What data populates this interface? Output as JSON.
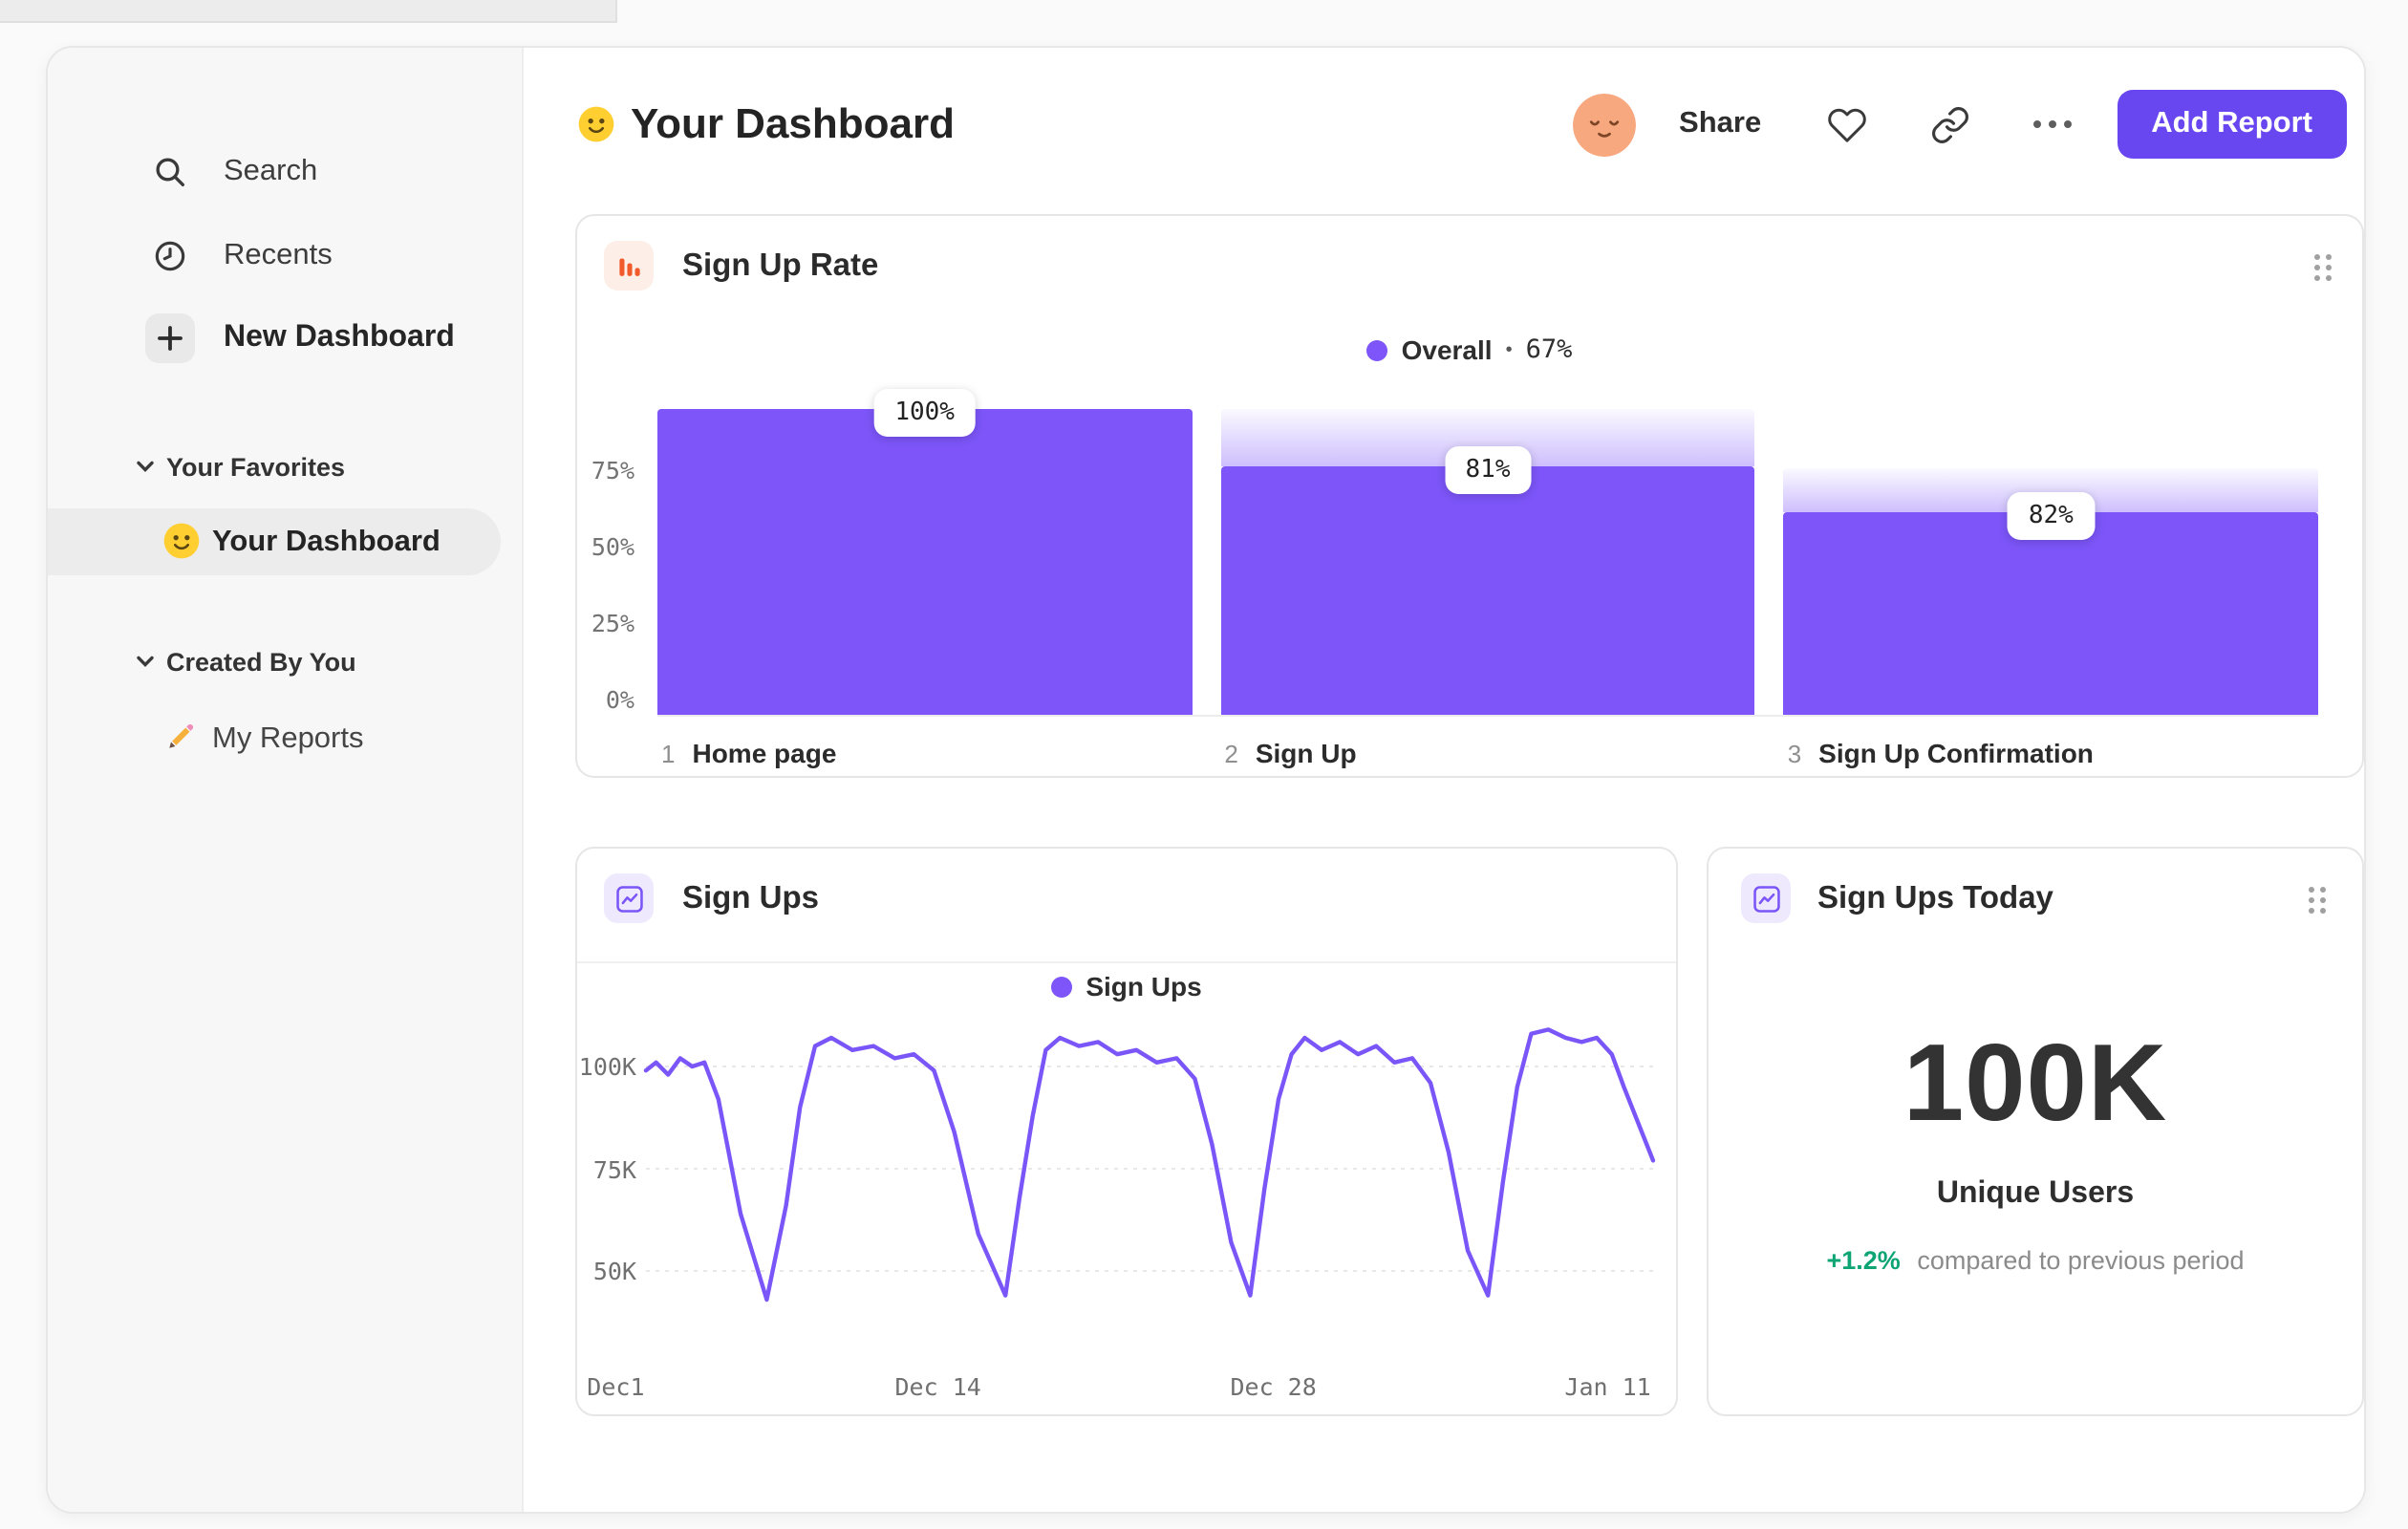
{
  "sidebar": {
    "nav": [
      {
        "icon": "search-icon",
        "label": "Search"
      },
      {
        "icon": "clock-icon",
        "label": "Recents"
      },
      {
        "icon": "plus-icon",
        "label": "New Dashboard"
      }
    ],
    "sections": [
      {
        "label": "Your Favorites",
        "items": [
          {
            "icon": "smiley-emoji-icon",
            "label": "Your Dashboard",
            "selected": true
          }
        ]
      },
      {
        "label": "Created By You",
        "items": [
          {
            "icon": "pencil-emoji-icon",
            "label": "My Reports",
            "selected": false
          }
        ]
      }
    ]
  },
  "header": {
    "title": "Your Dashboard",
    "title_icon": "smiley-emoji-icon",
    "avatar_icon": "relieved-face-avatar",
    "share": "Share",
    "add_report": "Add Report"
  },
  "funnel_card": {
    "title": "Sign Up Rate",
    "icon": "funnel-chart-icon",
    "legend": {
      "label": "Overall",
      "separator": "•",
      "value": "67%"
    },
    "chart_data": {
      "type": "bar",
      "subtype": "funnel",
      "overall_conversion": "67%",
      "ymax_pct": 100,
      "y_ticks": [
        "75%",
        "50%",
        "25%",
        "0%"
      ],
      "steps": [
        {
          "index": "1",
          "label": "Home page",
          "conversion_from_previous": "100%",
          "overall_pct": 100,
          "previous_overall_pct": 100
        },
        {
          "index": "2",
          "label": "Sign Up",
          "conversion_from_previous": "81%",
          "overall_pct": 81,
          "previous_overall_pct": 100
        },
        {
          "index": "3",
          "label": "Sign Up Confirmation",
          "conversion_from_previous": "82%",
          "overall_pct": 66.4,
          "previous_overall_pct": 81
        }
      ]
    }
  },
  "line_card": {
    "title": "Sign Ups",
    "icon": "line-chart-icon",
    "legend": {
      "label": "Sign Ups"
    },
    "chart_data": {
      "type": "line",
      "series_name": "Sign Ups",
      "unit": "K",
      "ylim": [
        40,
        112
      ],
      "y_ticks": [
        {
          "label": "100K",
          "value": 100
        },
        {
          "label": "75K",
          "value": 75
        },
        {
          "label": "50K",
          "value": 50
        }
      ],
      "x_ticks": [
        {
          "label": "Dec1",
          "frac": -0.03
        },
        {
          "label": "Dec 14",
          "frac": 0.29
        },
        {
          "label": "Dec 28",
          "frac": 0.623
        },
        {
          "label": "Jan 11",
          "frac": 0.955
        }
      ],
      "points_frac_value_k": [
        [
          0.0,
          99
        ],
        [
          0.01,
          101
        ],
        [
          0.022,
          98
        ],
        [
          0.034,
          102
        ],
        [
          0.046,
          100
        ],
        [
          0.058,
          101
        ],
        [
          0.072,
          92
        ],
        [
          0.094,
          64
        ],
        [
          0.12,
          43
        ],
        [
          0.139,
          66
        ],
        [
          0.153,
          90
        ],
        [
          0.168,
          105
        ],
        [
          0.184,
          107
        ],
        [
          0.205,
          104
        ],
        [
          0.226,
          105
        ],
        [
          0.247,
          102
        ],
        [
          0.266,
          103
        ],
        [
          0.286,
          99
        ],
        [
          0.306,
          84
        ],
        [
          0.33,
          59
        ],
        [
          0.357,
          44
        ],
        [
          0.371,
          68
        ],
        [
          0.384,
          88
        ],
        [
          0.397,
          104
        ],
        [
          0.411,
          107
        ],
        [
          0.43,
          105
        ],
        [
          0.449,
          106
        ],
        [
          0.468,
          103
        ],
        [
          0.487,
          104
        ],
        [
          0.507,
          101
        ],
        [
          0.527,
          102
        ],
        [
          0.545,
          97
        ],
        [
          0.562,
          81
        ],
        [
          0.581,
          57
        ],
        [
          0.6,
          44
        ],
        [
          0.614,
          70
        ],
        [
          0.628,
          92
        ],
        [
          0.641,
          103
        ],
        [
          0.654,
          107
        ],
        [
          0.671,
          104
        ],
        [
          0.689,
          106
        ],
        [
          0.707,
          103
        ],
        [
          0.725,
          105
        ],
        [
          0.743,
          101
        ],
        [
          0.761,
          102
        ],
        [
          0.779,
          96
        ],
        [
          0.797,
          79
        ],
        [
          0.816,
          55
        ],
        [
          0.836,
          44
        ],
        [
          0.851,
          72
        ],
        [
          0.865,
          95
        ],
        [
          0.879,
          108
        ],
        [
          0.896,
          109
        ],
        [
          0.913,
          107
        ],
        [
          0.929,
          106
        ],
        [
          0.944,
          107
        ],
        [
          0.959,
          103
        ],
        [
          0.971,
          95
        ],
        [
          1.0,
          77
        ]
      ]
    }
  },
  "today_card": {
    "title": "Sign Ups Today",
    "icon": "line-chart-icon",
    "value": "100K",
    "value_label": "Unique Users",
    "delta": "+1.2%",
    "delta_note": "compared to previous period"
  },
  "colors": {
    "accent_purple": "#7856F8",
    "bar_purple": "#7D55F9",
    "button_purple": "#6847F0",
    "icon_orange": "#F15B2C",
    "positive_green": "#0EA474",
    "sidebar_bg": "#F7F7F8",
    "selected_pill": "#ECECEC"
  }
}
